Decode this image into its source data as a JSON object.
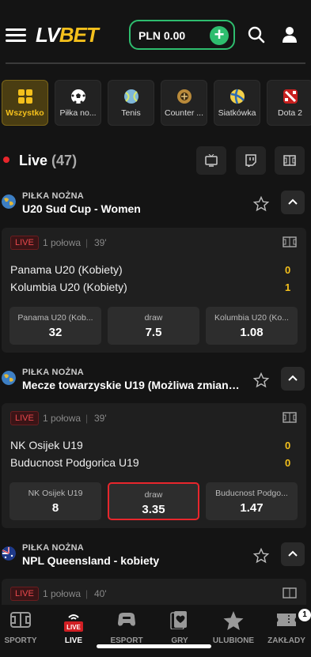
{
  "header": {
    "logo_lv": "LV",
    "logo_bet": "BET",
    "balance": "PLN 0.00",
    "plus": "+"
  },
  "categories": [
    {
      "label": "Wszystko",
      "icon": "grid-icon"
    },
    {
      "label": "Piłka no...",
      "icon": "soccer-ball-icon"
    },
    {
      "label": "Tenis",
      "icon": "tennis-ball-icon"
    },
    {
      "label": "Counter ...",
      "icon": "counter-strike-icon"
    },
    {
      "label": "Siatkówka",
      "icon": "volleyball-icon"
    },
    {
      "label": "Dota 2",
      "icon": "dota-icon"
    }
  ],
  "live": {
    "title": "Live",
    "count": "(47)"
  },
  "events": [
    {
      "sport": "PIŁKA NOŻNA",
      "league": "U20 Sud Cup - Women",
      "status": "LIVE",
      "period": "1 połowa",
      "separator": "|",
      "minute": "39'",
      "home": "Panama U20 (Kobiety)",
      "away": "Kolumbia U20 (Kobiety)",
      "home_score": "0",
      "away_score": "1",
      "odds": [
        {
          "label": "Panama U20 (Kob...",
          "value": "32"
        },
        {
          "label": "draw",
          "value": "7.5"
        },
        {
          "label": "Kolumbia U20 (Ko...",
          "value": "1.08"
        }
      ]
    },
    {
      "sport": "PIŁKA NOŻNA",
      "league": "Mecze towarzyskie U19 (Możliwa zmiana f...",
      "status": "LIVE",
      "period": "1 połowa",
      "separator": "|",
      "minute": "39'",
      "home": "NK Osijek U19",
      "away": "Buducnost Podgorica U19",
      "home_score": "0",
      "away_score": "0",
      "odds": [
        {
          "label": "NK Osijek U19",
          "value": "8"
        },
        {
          "label": "draw",
          "value": "3.35"
        },
        {
          "label": "Buducnost Podgo...",
          "value": "1.47"
        }
      ]
    },
    {
      "sport": "PIŁKA NOŻNA",
      "league": "NPL Queensland - kobiety",
      "status": "LIVE",
      "period": "1 połowa",
      "separator": "|",
      "minute": "40'"
    }
  ],
  "bottom_nav": [
    {
      "label": "SPORTY",
      "icon": "stadium-icon"
    },
    {
      "label": "LIVE",
      "icon": "live-icon"
    },
    {
      "label": "ESPORT",
      "icon": "gamepad-icon"
    },
    {
      "label": "GRY",
      "icon": "cards-icon"
    },
    {
      "label": "ULUBIONE",
      "icon": "star-icon"
    },
    {
      "label": "ZAKŁADY",
      "icon": "ticket-icon"
    }
  ],
  "bet_count": "1",
  "colors": {
    "accent": "#f4c01c",
    "green": "#2ebd6e",
    "live_red": "#e8262c",
    "background": "#141414"
  }
}
